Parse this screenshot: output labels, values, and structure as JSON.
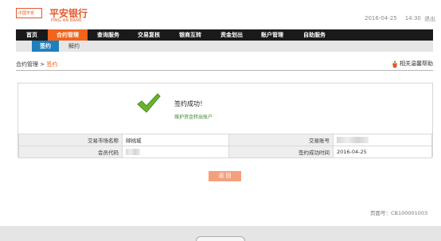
{
  "header": {
    "logo_badge": "中国平安",
    "bank_name": "平安银行",
    "bank_name_en": "PING AN BANK",
    "date": "2016-04-25",
    "time": "14:30",
    "exit_label": "退出"
  },
  "nav": {
    "items": [
      {
        "label": "首页"
      },
      {
        "label": "合约管理"
      },
      {
        "label": "查询服务"
      },
      {
        "label": "交易复核"
      },
      {
        "label": "银商互转"
      },
      {
        "label": "资金划出"
      },
      {
        "label": "账户管理"
      },
      {
        "label": "自助服务"
      }
    ],
    "active_index": 1
  },
  "subnav": {
    "items": [
      {
        "label": "签约"
      },
      {
        "label": "解约"
      }
    ],
    "active_index": 0
  },
  "breadcrumb": {
    "parent": "合约管理",
    "separator": ">",
    "current": "签约"
  },
  "help": {
    "label": "相关温馨帮助"
  },
  "result": {
    "title": "签约成功！",
    "link_text": "维护资金转出账户"
  },
  "info": {
    "market_name_label": "交易市场名称",
    "market_name_value": "邮桃城",
    "trade_account_label": "交易账号",
    "member_code_label": "会员代码",
    "sign_time_label": "签约成功时间",
    "sign_time_value": "2016-04-25"
  },
  "actions": {
    "back_label": "返 回"
  },
  "footer": {
    "page_id": "页面号：CB100001003"
  },
  "colors": {
    "accent_orange": "#f2631b",
    "nav_dark": "#1a1a1a",
    "subnav_blue": "#1f7fbd",
    "success_green": "#3f8a24",
    "brand_orange": "#e2582b"
  }
}
